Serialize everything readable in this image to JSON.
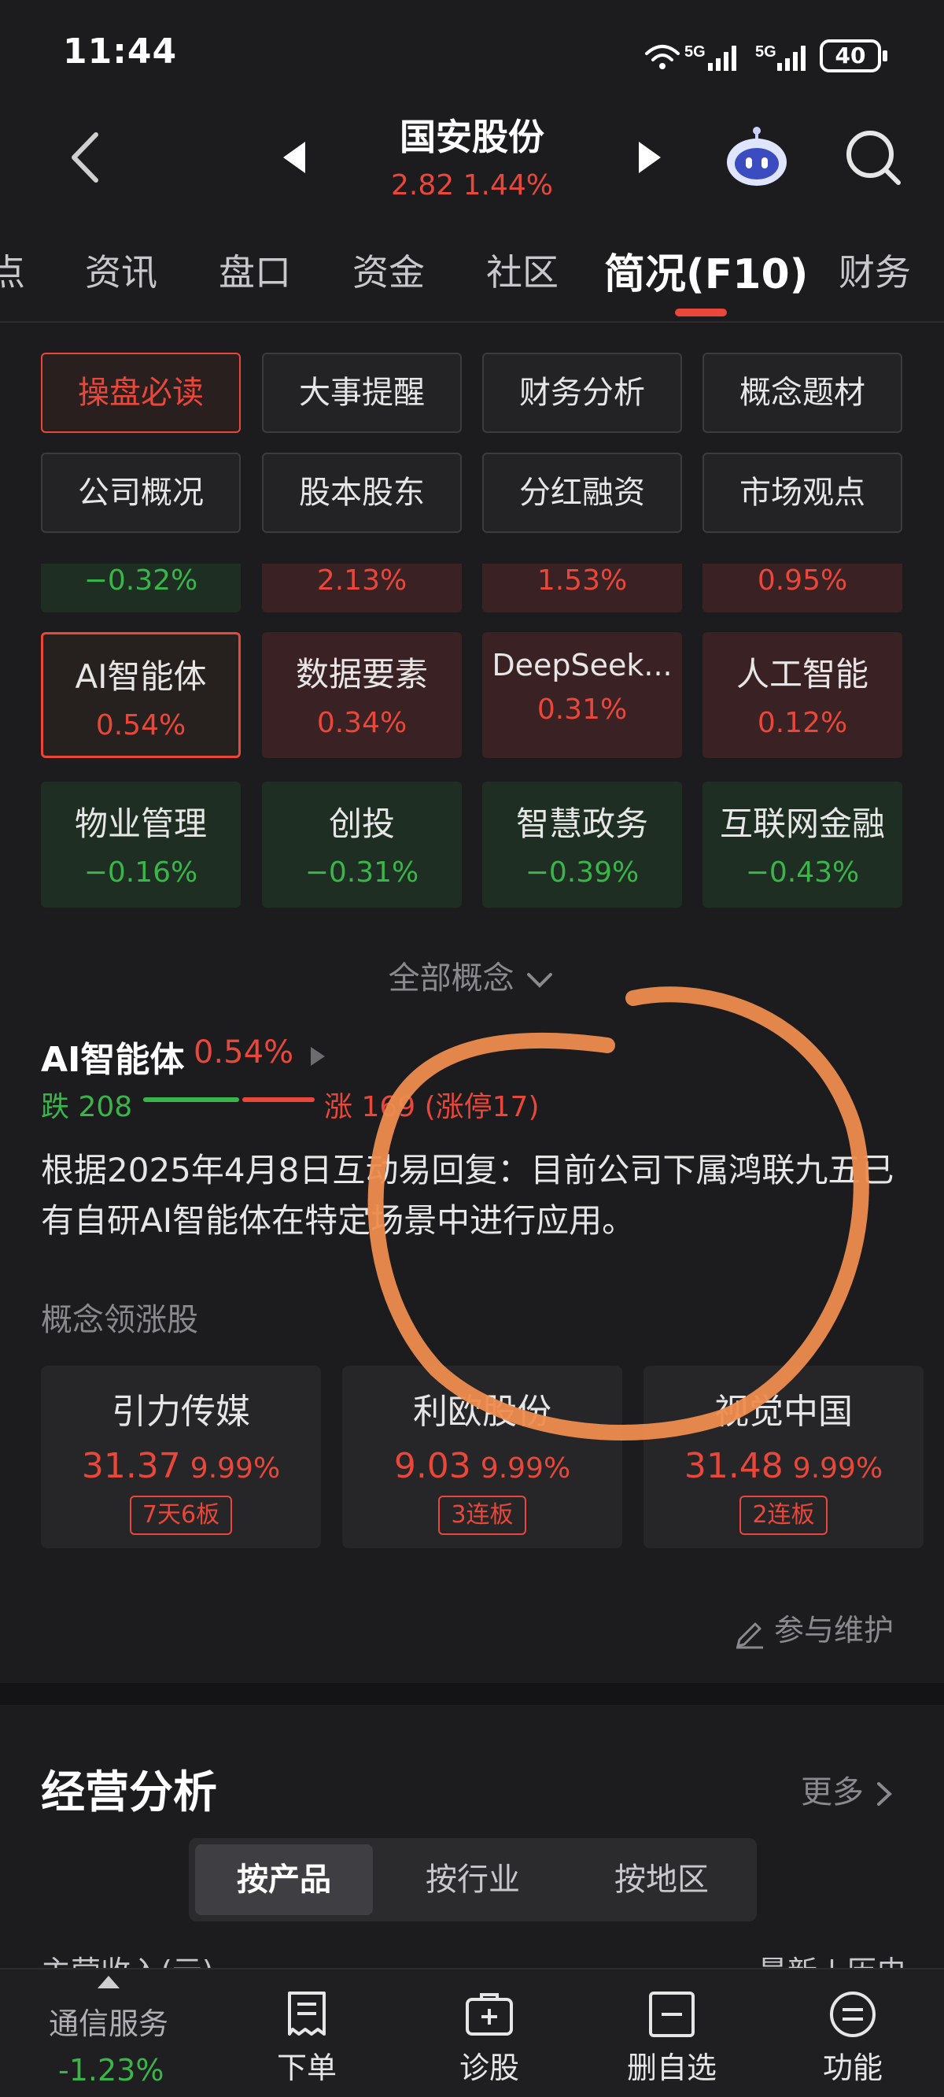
{
  "status_bar": {
    "time": "11:44",
    "battery": "40",
    "net1": "5G",
    "net2": "5G"
  },
  "header": {
    "title": "国安股份",
    "price": "2.82",
    "change": "1.44%"
  },
  "tabs": [
    {
      "label": "点"
    },
    {
      "label": "资讯"
    },
    {
      "label": "盘口"
    },
    {
      "label": "资金"
    },
    {
      "label": "社区"
    },
    {
      "label": "简况(F10)",
      "active": true
    },
    {
      "label": "财务"
    }
  ],
  "grid_buttons": [
    {
      "label": "操盘必读",
      "active": true
    },
    {
      "label": "大事提醒"
    },
    {
      "label": "财务分析"
    },
    {
      "label": "概念题材"
    },
    {
      "label": "公司概况"
    },
    {
      "label": "股本股东"
    },
    {
      "label": "分红融资"
    },
    {
      "label": "市场观点"
    }
  ],
  "cut_tiles": [
    {
      "pct": "−0.32%",
      "dir": "down"
    },
    {
      "pct": "2.13%",
      "dir": "up"
    },
    {
      "pct": "1.53%",
      "dir": "up"
    },
    {
      "pct": "0.95%",
      "dir": "up"
    }
  ],
  "concept_tiles": [
    {
      "name": "AI智能体",
      "pct": "0.54%",
      "dir": "up",
      "selected": true
    },
    {
      "name": "数据要素",
      "pct": "0.34%",
      "dir": "up"
    },
    {
      "name": "DeepSeek...",
      "pct": "0.31%",
      "dir": "up"
    },
    {
      "name": "人工智能",
      "pct": "0.12%",
      "dir": "up"
    },
    {
      "name": "物业管理",
      "pct": "−0.16%",
      "dir": "down"
    },
    {
      "name": "创投",
      "pct": "−0.31%",
      "dir": "down"
    },
    {
      "name": "智慧政务",
      "pct": "−0.39%",
      "dir": "down"
    },
    {
      "name": "互联网金融",
      "pct": "−0.43%",
      "dir": "down"
    }
  ],
  "all_concepts_label": "全部概念",
  "concept_detail": {
    "name": "AI智能体",
    "pct": "0.54%",
    "fall_label": "跌 208",
    "rise_label": "涨 169 (涨停17)",
    "description": "根据2025年4月8日互动易回复：目前公司下属鸿联九五已有自研AI智能体在特定场景中进行应用。"
  },
  "leaders": {
    "title": "概念领涨股",
    "items": [
      {
        "name": "引力传媒",
        "price": "31.37",
        "change": "9.99%",
        "badge": "7天6板"
      },
      {
        "name": "利欧股份",
        "price": "9.03",
        "change": "9.99%",
        "badge": "3连板"
      },
      {
        "name": "视觉中国",
        "price": "31.48",
        "change": "9.99%",
        "badge": "2连板"
      }
    ]
  },
  "maintain_label": "参与维护",
  "business": {
    "title": "经营分析",
    "more": "更多",
    "segments": [
      {
        "label": "按产品",
        "active": true
      },
      {
        "label": "按行业"
      },
      {
        "label": "按地区"
      }
    ],
    "cut_left": "主营收入(元)",
    "cut_right": "最新 | 历史"
  },
  "bottom_bar": {
    "sector": "通信服务",
    "sector_pct": "-1.23%",
    "items": [
      {
        "label": "下单",
        "icon": "order-icon"
      },
      {
        "label": "诊股",
        "icon": "diagnose-icon"
      },
      {
        "label": "删自选",
        "icon": "remove-watchlist-icon"
      },
      {
        "label": "功能",
        "icon": "menu-icon"
      }
    ]
  },
  "colors": {
    "up": "#e8473a",
    "down": "#39b54a",
    "annotation": "#ee8c4e"
  }
}
